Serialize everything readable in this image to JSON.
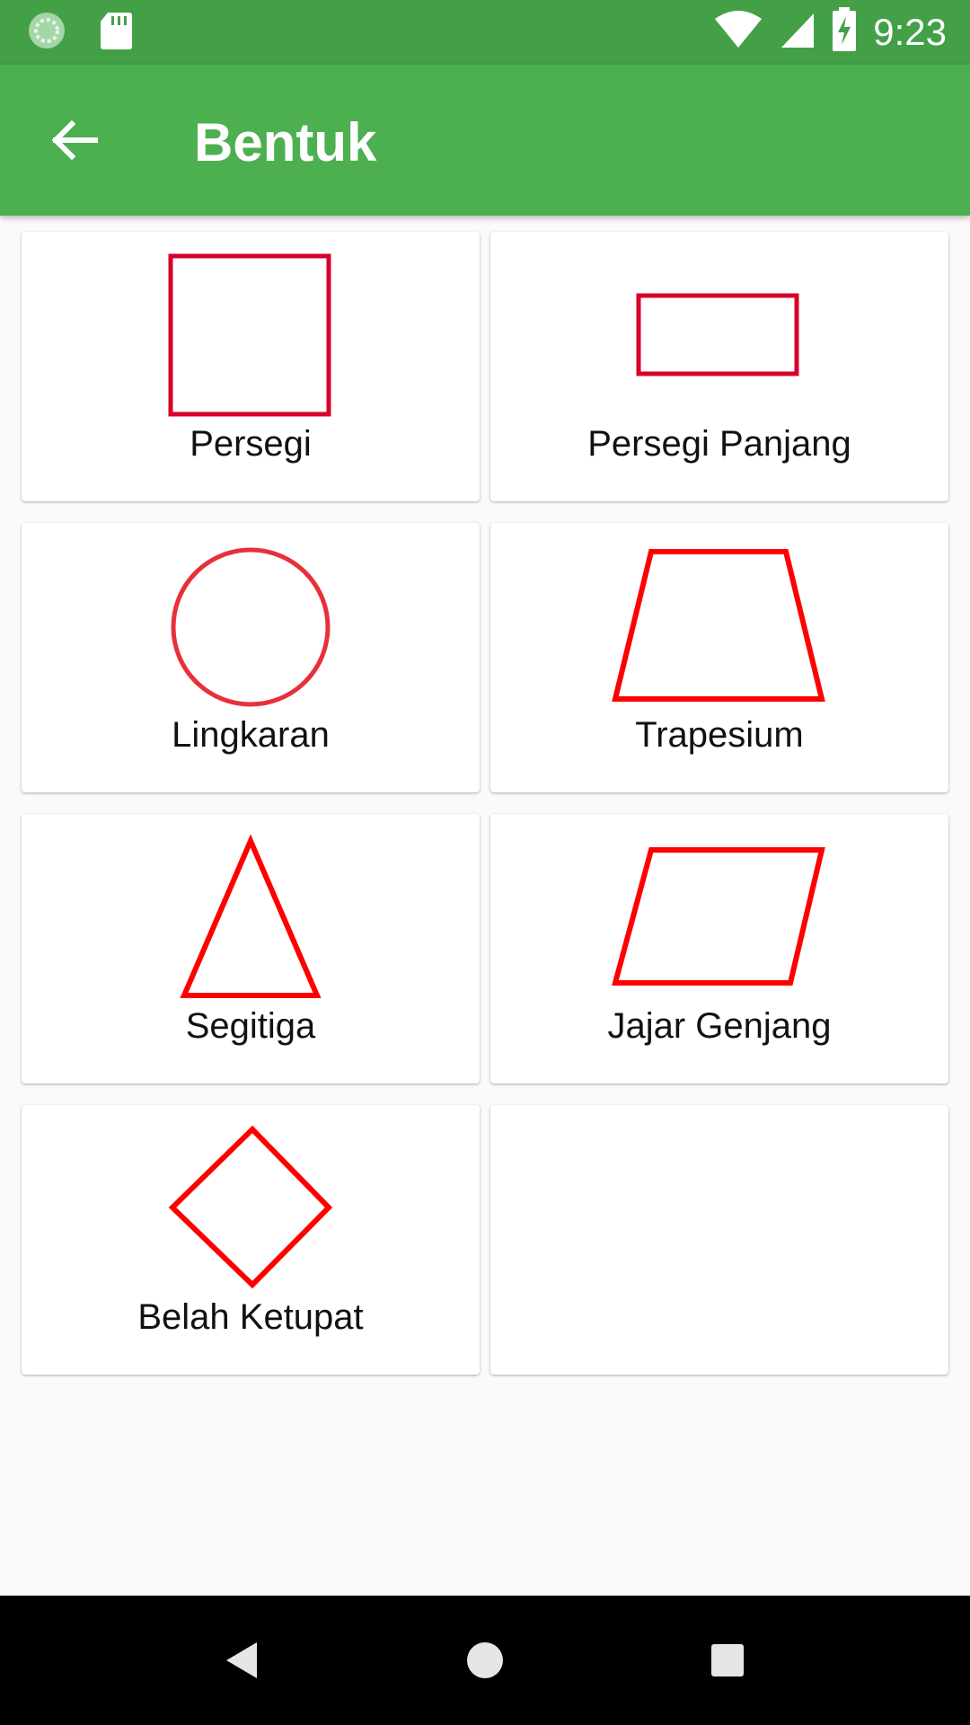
{
  "status_bar": {
    "time": "9:23",
    "icons": [
      "loading-circle-icon",
      "sd-card-icon",
      "wifi-icon",
      "cell-signal-icon",
      "battery-charging-icon"
    ]
  },
  "app_bar": {
    "title": "Bentuk",
    "back_icon": "arrow-back-icon"
  },
  "shapes": [
    {
      "label": "Persegi",
      "icon": "square-icon"
    },
    {
      "label": "Persegi Panjang",
      "icon": "rectangle-icon"
    },
    {
      "label": "Lingkaran",
      "icon": "circle-icon"
    },
    {
      "label": "Trapesium",
      "icon": "trapezoid-icon"
    },
    {
      "label": "Segitiga",
      "icon": "triangle-icon"
    },
    {
      "label": "Jajar Genjang",
      "icon": "parallelogram-icon"
    },
    {
      "label": "Belah Ketupat",
      "icon": "rhombus-icon"
    }
  ],
  "nav_bar": {
    "buttons": [
      "back-triangle-icon",
      "home-circle-icon",
      "recents-square-icon"
    ]
  },
  "colors": {
    "status_bar": "#43a047",
    "app_bar": "#4caf50",
    "shape_stroke": "#d6002a",
    "shape_stroke_bright": "#ff0000"
  }
}
